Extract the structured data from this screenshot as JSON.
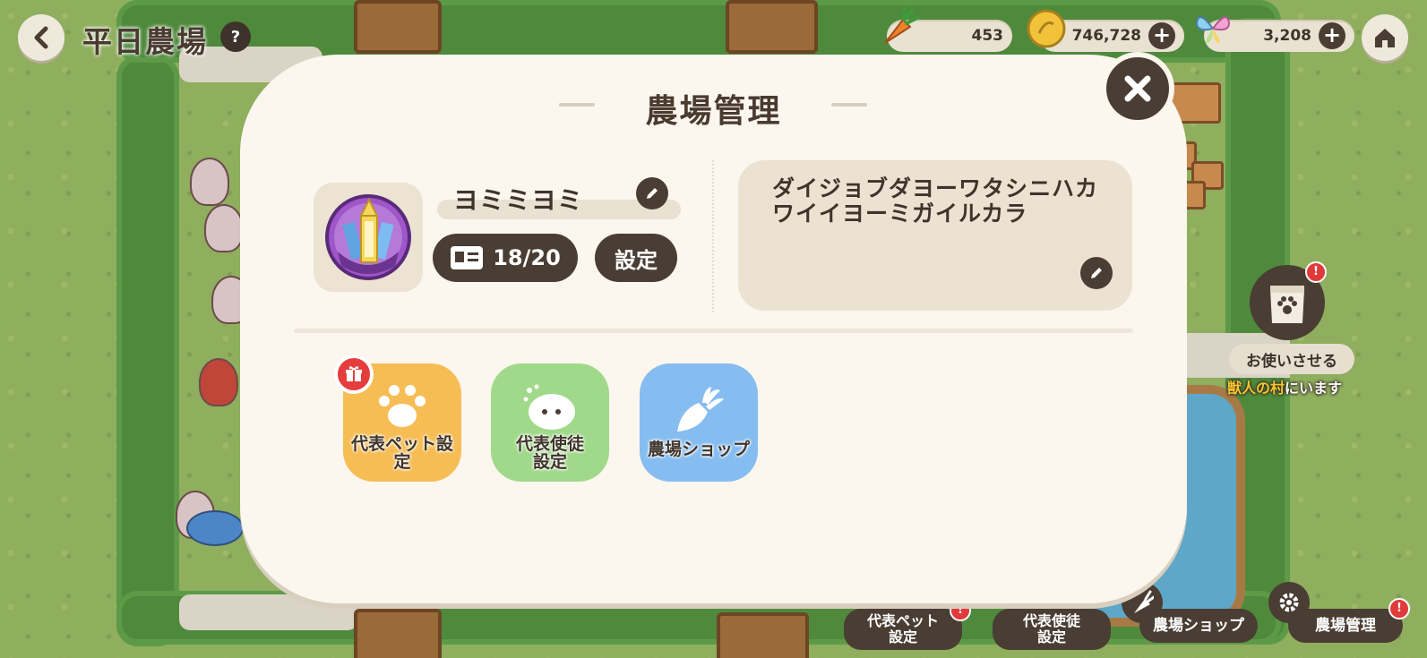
{
  "header": {
    "farm_title": "平日農場",
    "help_label": "?"
  },
  "resources": {
    "carrot": "453",
    "coin": "746,728",
    "butterfly": "3,208",
    "plus": "+"
  },
  "side": {
    "errand_label": "お使いさせる",
    "errand_sub_highlight": "獣人の村",
    "errand_sub_rest": "にいます",
    "alert_mark": "!"
  },
  "bottom_bar": {
    "pet_setting": "代表ペット\n設定",
    "disciple_setting": "代表使徒\n設定",
    "shop": "農場ショップ",
    "manage": "農場管理"
  },
  "modal": {
    "title": "農場管理",
    "user_name": "ヨミミヨミ",
    "card_count": "18/20",
    "settings_button": "設定",
    "bio": "ダイジョブダヨーワタシニハカワイイヨーミガイルカラ",
    "tiles": [
      {
        "label": "代表ペット設定",
        "color": "#f7bd55"
      },
      {
        "label": "代表使徒\n設定",
        "color": "#a0d98a"
      },
      {
        "label": "農場ショップ",
        "color": "#86bdf0"
      }
    ]
  }
}
